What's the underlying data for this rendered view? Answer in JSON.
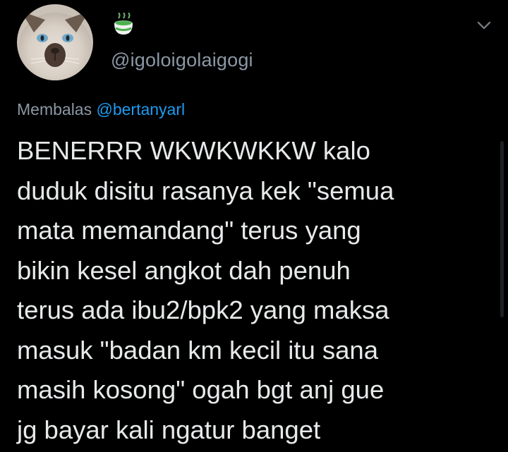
{
  "tweet": {
    "author": {
      "display_name_icon": "matcha-cup-icon",
      "handle": "@igoloigolaigogi"
    },
    "reply_prefix": "Membalas ",
    "reply_to": "@bertanyarl",
    "text_lines": [
      "BENERRR WKWKWKKW kalo",
      "duduk disitu rasanya kek \"semua",
      "mata memandang\" terus yang",
      "bikin kesel angkot dah penuh",
      "terus ada ibu2/bpk2 yang maksa",
      "masuk \"badan km kecil itu sana",
      "masih kosong\" ogah bgt anj gue",
      "jg bayar kali ngatur banget"
    ]
  },
  "colors": {
    "background": "#000000",
    "text": "#e7e9ea",
    "secondary": "#8b98a5",
    "link": "#1d9bf0",
    "emoji_green": "#4caf50"
  }
}
